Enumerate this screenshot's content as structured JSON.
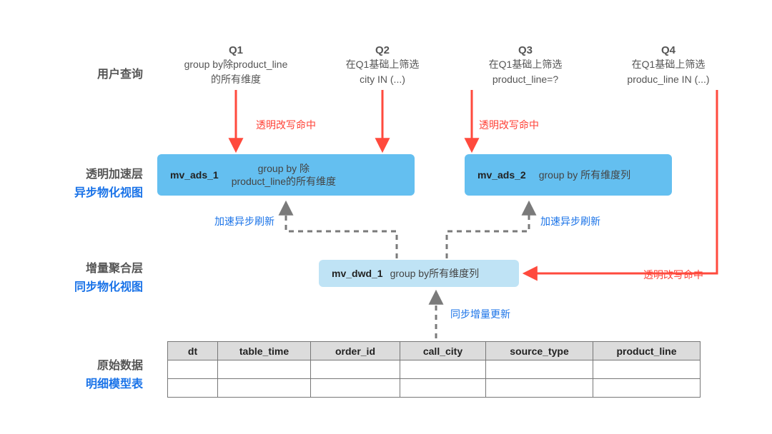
{
  "rows": {
    "r1": {
      "grey": "用户查询"
    },
    "r2": {
      "grey": "透明加速层",
      "blue": "异步物化视图"
    },
    "r3": {
      "grey": "增量聚合层",
      "blue": "同步物化视图"
    },
    "r4": {
      "grey": "原始数据",
      "blue": "明细模型表"
    }
  },
  "queries": {
    "q1": {
      "id": "Q1",
      "l1": "group by除product_line",
      "l2": "的所有维度"
    },
    "q2": {
      "id": "Q2",
      "l1": "在Q1基础上筛选",
      "l2": "city IN (...)"
    },
    "q3": {
      "id": "Q3",
      "l1": "在Q1基础上筛选",
      "l2": "product_line=?"
    },
    "q4": {
      "id": "Q4",
      "l1": "在Q1基础上筛选",
      "l2": "produc_line IN (...)"
    }
  },
  "mv": {
    "ads1": {
      "name": "mv_ads_1",
      "desc1": "group by 除",
      "desc2": "product_line的所有维度"
    },
    "ads2": {
      "name": "mv_ads_2",
      "desc": "group by 所有维度列"
    },
    "dwd1": {
      "name": "mv_dwd_1",
      "desc": "group by所有维度列"
    }
  },
  "ann": {
    "rewrite_hit_1": "透明改写命中",
    "rewrite_hit_2": "透明改写命中",
    "rewrite_hit_3": "透明改写命中",
    "async_refresh_1": "加速异步刷新",
    "async_refresh_2": "加速异步刷新",
    "sync_inc_update": "同步增量更新"
  },
  "table": {
    "cols": [
      "dt",
      "table_time",
      "order_id",
      "call_city",
      "source_type",
      "product_line"
    ]
  },
  "colors": {
    "arrow_red": "#ff4a3d",
    "arrow_grey": "#7a7a7a",
    "accent_blue": "#1a73e8",
    "box_blue": "#64bff0",
    "box_light": "#bfe3f5"
  }
}
